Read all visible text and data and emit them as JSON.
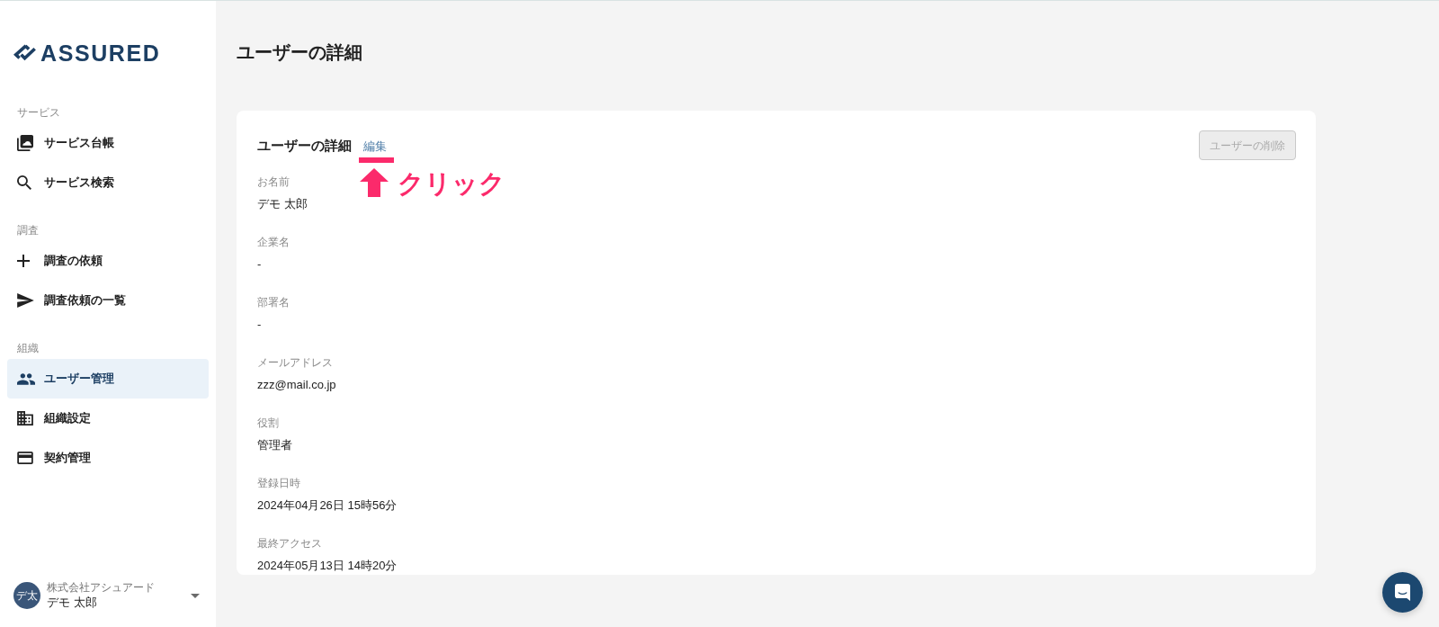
{
  "sidebar": {
    "logo": "ASSURED",
    "sections": [
      {
        "title": "サービス",
        "items": [
          {
            "label": "サービス台帳",
            "kind": "ledger",
            "selected": false
          },
          {
            "label": "サービス検索",
            "kind": "search",
            "selected": false
          }
        ]
      },
      {
        "title": "調査",
        "items": [
          {
            "label": "調査の依頼",
            "kind": "add",
            "selected": false
          },
          {
            "label": "調査依頼の一覧",
            "kind": "sent",
            "selected": false
          }
        ]
      },
      {
        "title": "組織",
        "items": [
          {
            "label": "ユーザー管理",
            "kind": "users",
            "selected": true
          },
          {
            "label": "組織設定",
            "kind": "organization",
            "selected": false
          },
          {
            "label": "契約管理",
            "kind": "contract",
            "selected": false
          }
        ]
      }
    ],
    "account": {
      "avatar": "デ太",
      "company": "株式会社アシュアード",
      "name": "デモ 太郎"
    }
  },
  "page_title": "ユーザーの詳細",
  "card": {
    "title": "ユーザーの詳細",
    "edit_link": "編集",
    "delete_button": {
      "label": "ユーザーの削除",
      "disabled": true
    },
    "fields": [
      {
        "label": "お名前",
        "value": "デモ 太郎"
      },
      {
        "label": "企業名",
        "value": "-"
      },
      {
        "label": "部署名",
        "value": "-"
      },
      {
        "label": "メールアドレス",
        "value": "zzz@mail.co.jp"
      },
      {
        "label": "役割",
        "value": "管理者"
      },
      {
        "label": "登録日時",
        "value": "2024年04月26日 15時56分"
      },
      {
        "label": "最終アクセス",
        "value": "2024年05月13日 14時20分"
      }
    ]
  },
  "annotation": {
    "text": "クリック"
  }
}
